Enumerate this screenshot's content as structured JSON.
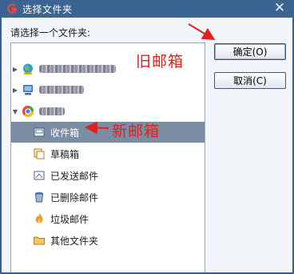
{
  "window": {
    "title": "选择文件夹",
    "close_glyph": "✕"
  },
  "prompt": "请选择一个文件夹:",
  "tree": {
    "accounts": [
      {
        "icon": "account-globe-icon",
        "expanded": false,
        "label_obscured": true
      },
      {
        "icon": "account-computer-icon",
        "expanded": false,
        "label_obscured": true
      },
      {
        "icon": "account-colorful-icon",
        "expanded": true,
        "label_obscured": true
      }
    ],
    "folders": [
      {
        "label": "收件箱",
        "icon": "inbox-icon",
        "selected": true
      },
      {
        "label": "草稿箱",
        "icon": "drafts-icon",
        "selected": false
      },
      {
        "label": "已发送邮件",
        "icon": "sent-icon",
        "selected": false
      },
      {
        "label": "已删除邮件",
        "icon": "trash-icon",
        "selected": false
      },
      {
        "label": "垃圾邮件",
        "icon": "junk-icon",
        "selected": false
      },
      {
        "label": "其他文件夹",
        "icon": "folder-icon",
        "selected": false
      }
    ]
  },
  "buttons": {
    "ok": "确定(O)",
    "cancel": "取消(C)"
  },
  "annotations": {
    "old_mailbox": "旧邮箱",
    "new_mailbox": "新邮箱"
  },
  "colors": {
    "titlebar": "#3b6493",
    "selection": "#7b8da3",
    "annotation": "#e22020"
  }
}
